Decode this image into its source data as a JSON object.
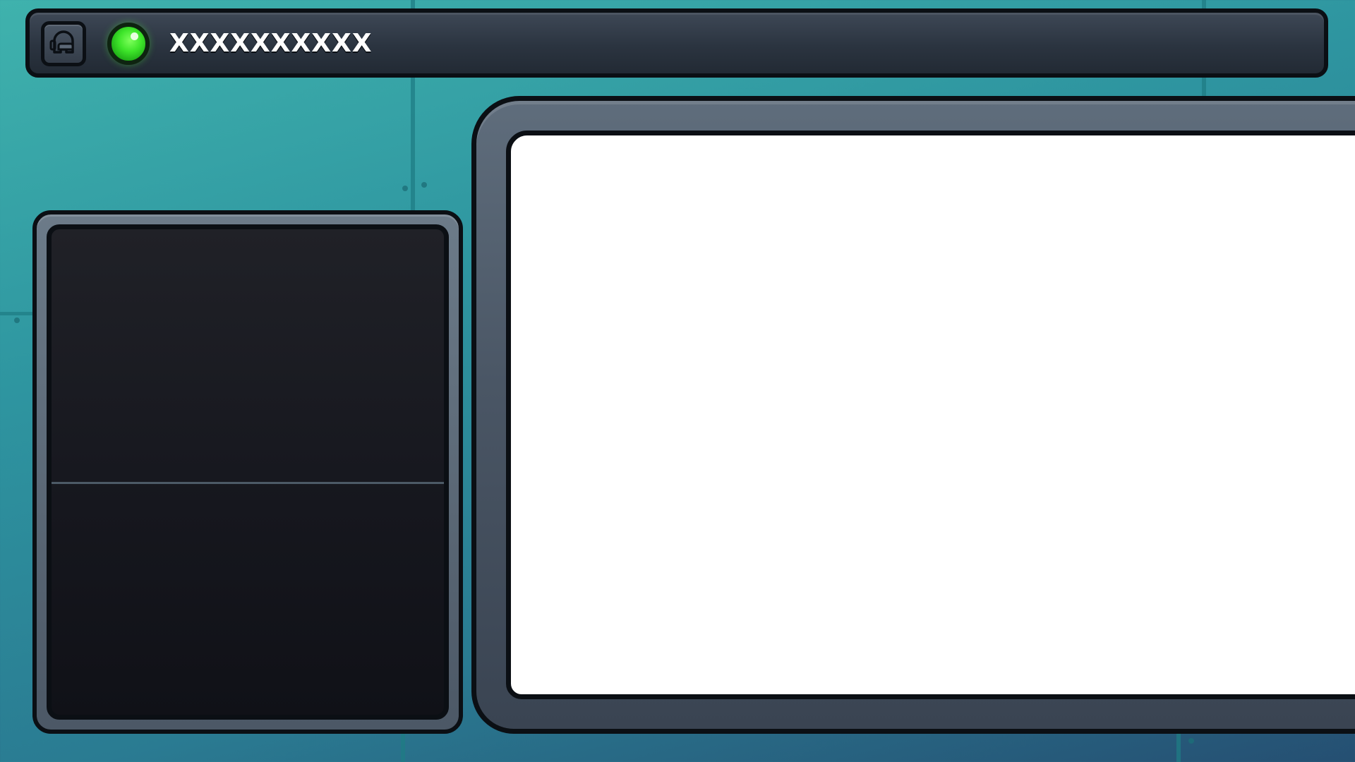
{
  "top_bar": {
    "player_name": "XXXXXXXXXX",
    "icon": "crewmate-icon",
    "status_light_color": "#3ee52a"
  },
  "left_panel": {
    "screen_color": "#1a1b22"
  },
  "right_panel": {
    "screen_color": "#ffffff"
  },
  "colors": {
    "background": "#2e95a0",
    "frame": "#4a5665",
    "outline": "#0b0f14"
  }
}
